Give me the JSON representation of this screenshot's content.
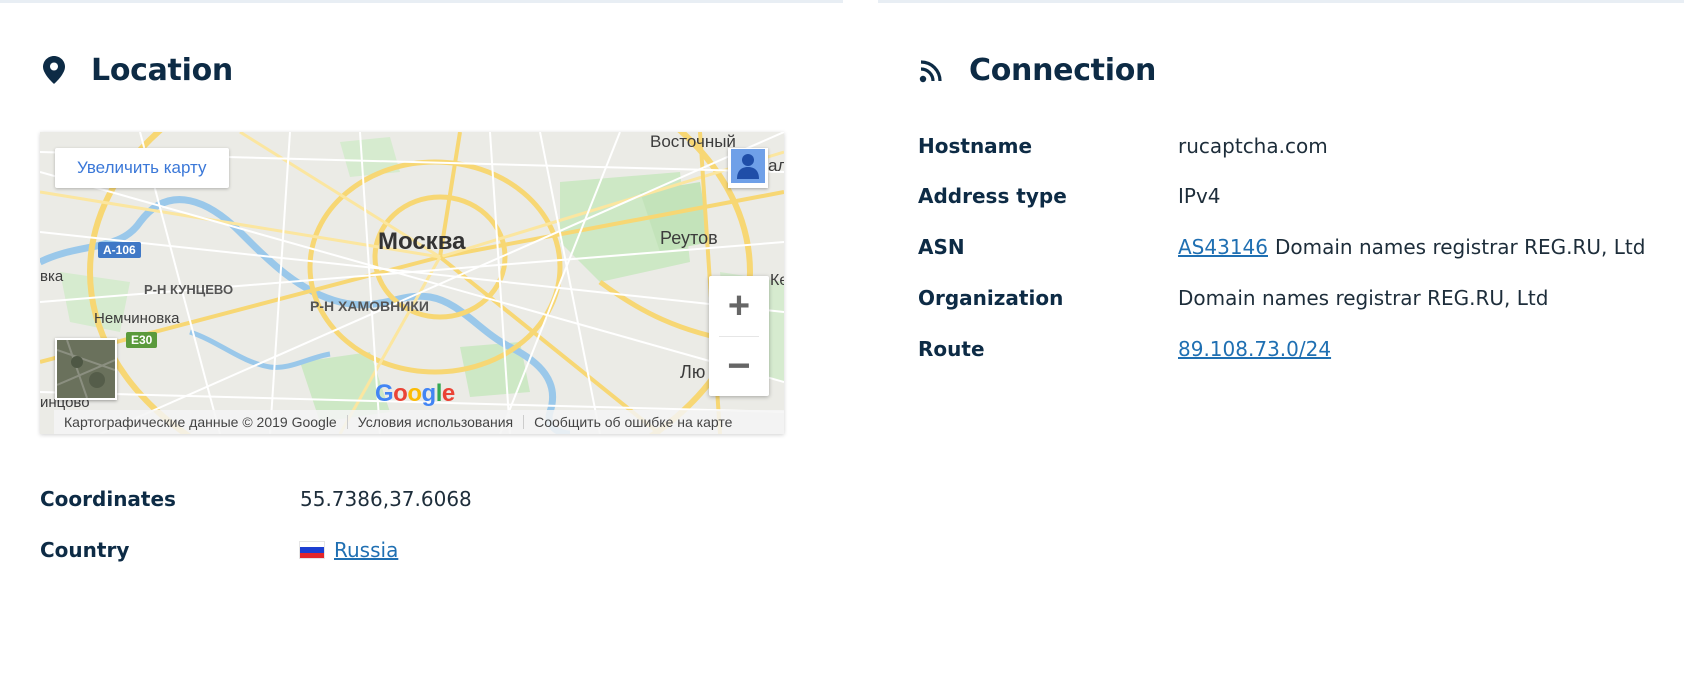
{
  "location": {
    "title": "Location",
    "icon": "map-pin-icon",
    "map": {
      "enlarge_label": "Увеличить карту",
      "labels": {
        "moscow": "Москва",
        "vostochny": "Восточный",
        "reutov": "Реутов",
        "kuntsevo": "Р-Н КУНЦЕВО",
        "khamovniki": "Р-Н ХАМОВНИКИ",
        "nemchinovka": "Немчиновка",
        "a106": "A-106",
        "e30": "E30",
        "vka": "вка",
        "intsovo": "инцово",
        "lyu": "Лю",
        "al": "ал",
        "ke": "Ке"
      },
      "zoom_in": "+",
      "zoom_out": "−",
      "google": [
        "G",
        "o",
        "o",
        "g",
        "l",
        "e"
      ],
      "footer": {
        "map_data": "Картографические данные © 2019 Google",
        "terms": "Условия использования",
        "report": "Сообщить об ошибке на карте"
      }
    },
    "rows": [
      {
        "label": "Coordinates",
        "value": "55.7386,37.6068"
      },
      {
        "label": "Country",
        "value": "Russia"
      }
    ]
  },
  "connection": {
    "title": "Connection",
    "icon": "rss-signal-icon",
    "rows": [
      {
        "label": "Hostname",
        "value": "rucaptcha.com"
      },
      {
        "label": "Address type",
        "value": "IPv4"
      },
      {
        "label": "ASN",
        "link": "AS43146",
        "value": "Domain names registrar REG.RU, Ltd"
      },
      {
        "label": "Organization",
        "value": "Domain names registrar REG.RU, Ltd"
      },
      {
        "label": "Route",
        "link": "89.108.73.0/24"
      }
    ]
  },
  "colors": {
    "heading": "#0d2b45",
    "link": "#1f6fb2",
    "map_button_text": "#3b78d8"
  }
}
